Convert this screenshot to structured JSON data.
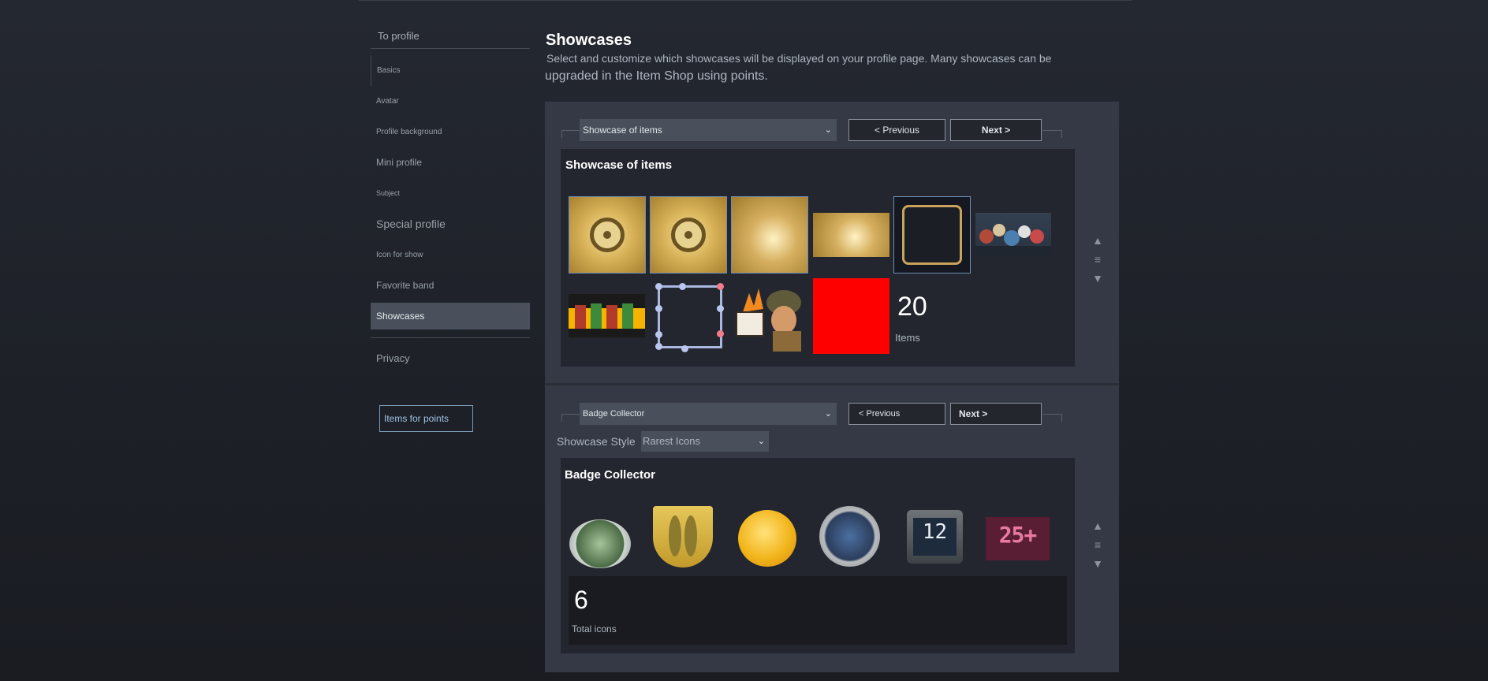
{
  "sidebar": {
    "to_profile": "To profile",
    "items": [
      {
        "label": "Basics"
      },
      {
        "label": "Avatar"
      },
      {
        "label": "Profile background"
      },
      {
        "label": "Mini profile"
      },
      {
        "label": "Subject"
      },
      {
        "label": "Special profile"
      },
      {
        "label": "Icon for show"
      },
      {
        "label": "Favorite band"
      },
      {
        "label": "Showcases"
      },
      {
        "label": "Privacy"
      }
    ],
    "points_button": "Items for points"
  },
  "header": {
    "title": "Showcases",
    "description_line1": "Select and customize which showcases will be displayed on your profile page. Many showcases can be",
    "description_line2": "upgraded in the Item Shop using points."
  },
  "showcase1": {
    "select_value": "Showcase of items",
    "prev_label": "< Previous",
    "next_label": "Next >",
    "title": "Showcase of items",
    "count": "20",
    "count_label": "Items"
  },
  "showcase2": {
    "select_value": "Badge Collector",
    "prev_label": "< Previous",
    "next_label": "Next >",
    "style_label": "Showcase Style",
    "style_value": "Rarest Icons",
    "title": "Badge Collector",
    "badge_number": "12",
    "badge_25": "25+",
    "count": "6",
    "count_label": "Total icons"
  },
  "controls": {
    "up": "▲",
    "menu": "≡",
    "down": "▼",
    "chevron": "⌄"
  }
}
